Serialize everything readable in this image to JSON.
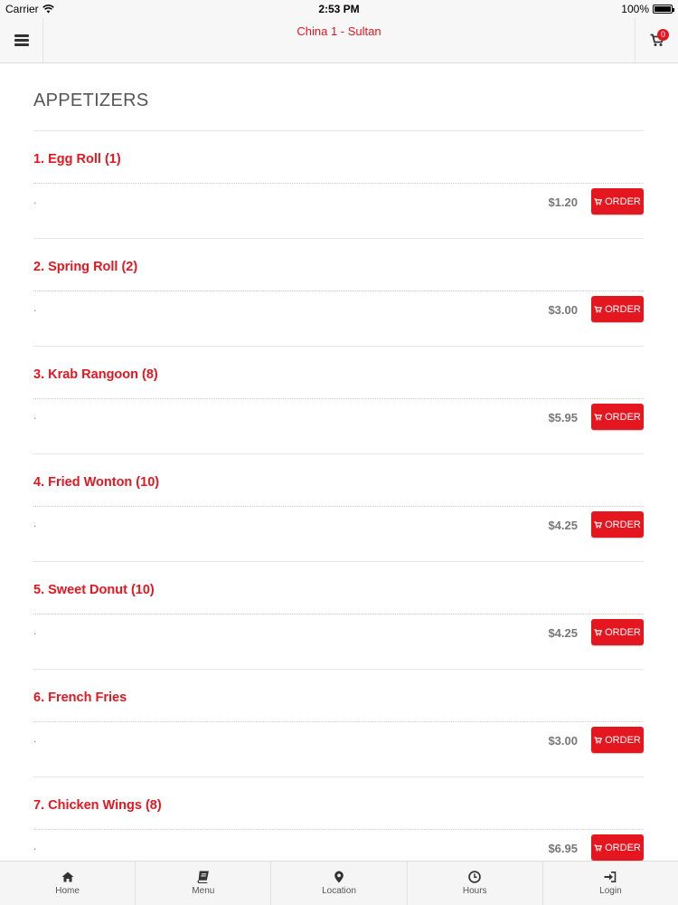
{
  "status_bar": {
    "carrier": "Carrier",
    "time": "2:53 PM",
    "battery": "100%"
  },
  "header": {
    "title": "China 1 - Sultan",
    "cart_count": "0"
  },
  "section": {
    "title": "APPETIZERS"
  },
  "order_label": "ORDER",
  "items": [
    {
      "name": "1. Egg Roll (1)",
      "desc": ".",
      "price": "$1.20"
    },
    {
      "name": "2. Spring Roll (2)",
      "desc": ".",
      "price": "$3.00"
    },
    {
      "name": "3. Krab Rangoon (8)",
      "desc": ".",
      "price": "$5.95"
    },
    {
      "name": "4. Fried Wonton (10)",
      "desc": ".",
      "price": "$4.25"
    },
    {
      "name": "5. Sweet Donut (10)",
      "desc": ".",
      "price": "$4.25"
    },
    {
      "name": "6. French Fries",
      "desc": ".",
      "price": "$3.00"
    },
    {
      "name": "7. Chicken Wings (8)",
      "desc": ".",
      "price": "$6.95"
    }
  ],
  "tabs": [
    {
      "label": "Home",
      "icon": "home-icon"
    },
    {
      "label": "Menu",
      "icon": "book-icon"
    },
    {
      "label": "Location",
      "icon": "map-pin-icon"
    },
    {
      "label": "Hours",
      "icon": "clock-icon"
    },
    {
      "label": "Login",
      "icon": "login-icon"
    }
  ],
  "colors": {
    "accent": "#e4161f",
    "header_bg": "#f7f7f7",
    "text_gray": "#777777"
  }
}
